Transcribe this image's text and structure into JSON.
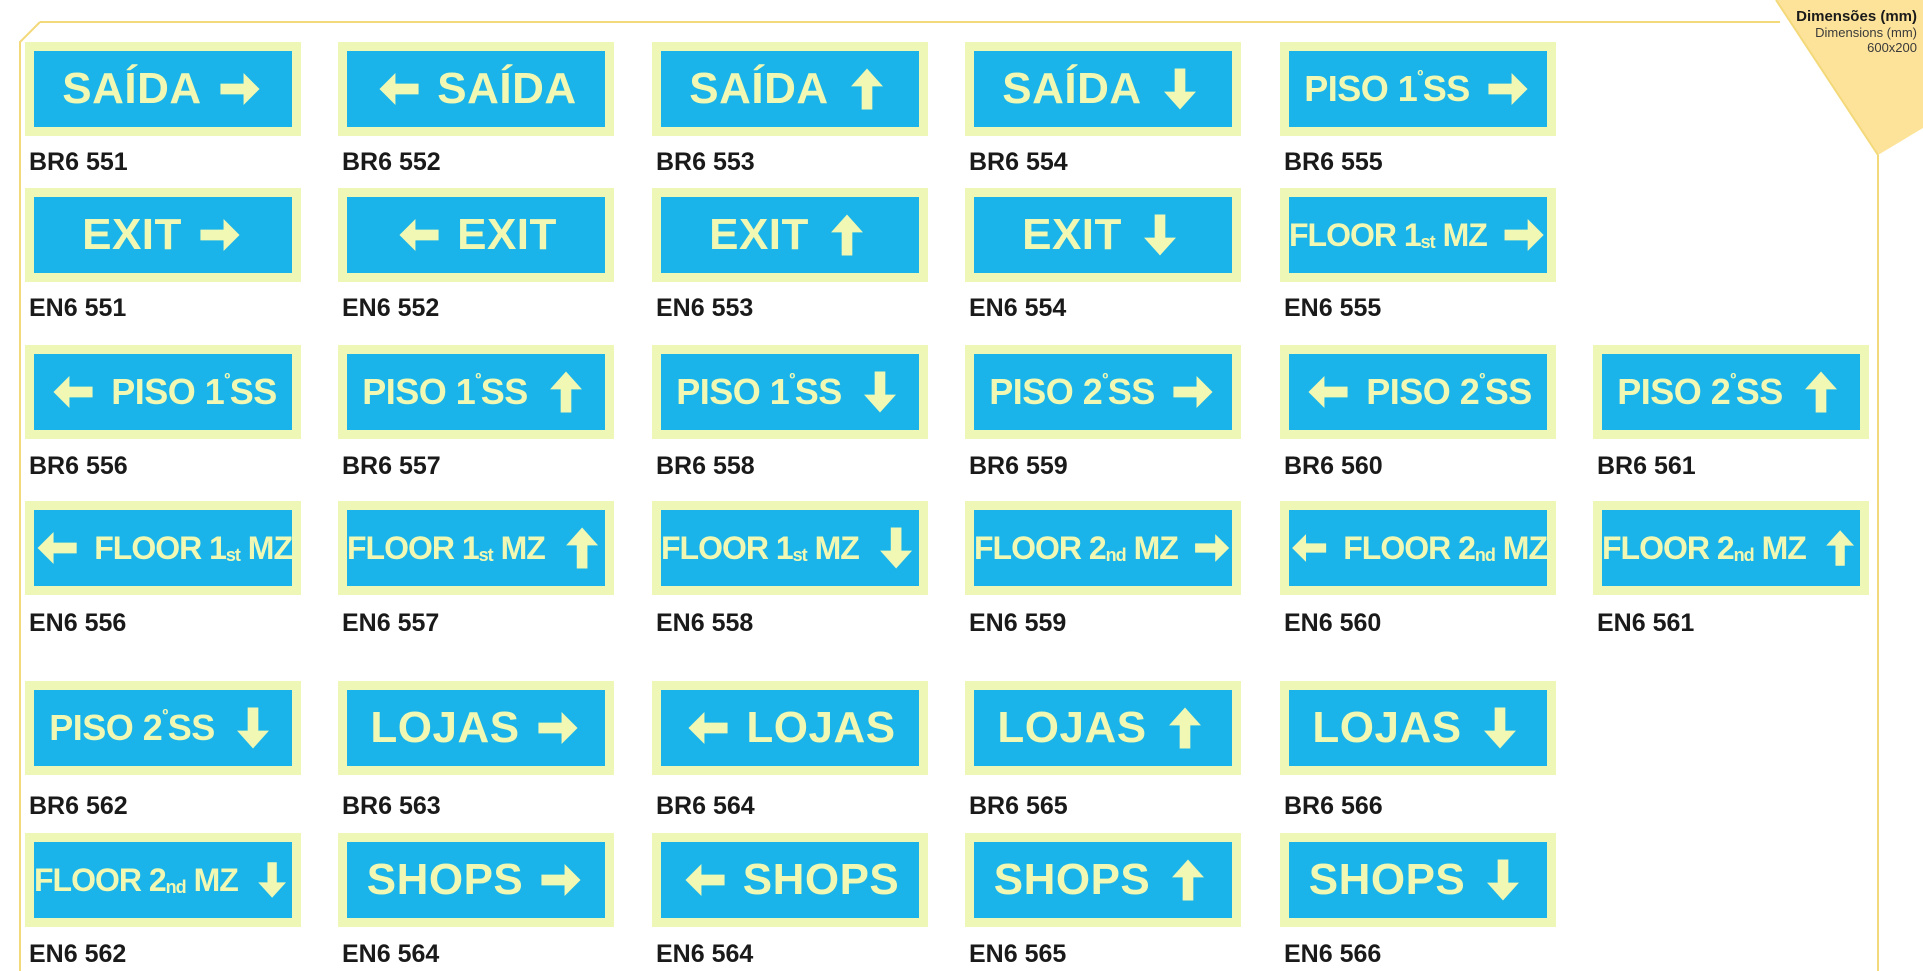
{
  "corner": {
    "title": "Dimensões (mm)",
    "subtitle": "Dimensions (mm)",
    "size": "600x200"
  },
  "colors": {
    "sign_bg": "#1ab4ea",
    "sign_border": "#eef7b6",
    "sign_text": "#f1f8b3",
    "frame_line": "#f3d97a",
    "corner_fill": "#fde39a"
  },
  "signs": [
    {
      "text": "SAÍDA",
      "arrow": "arrow-right",
      "code": "BR6 551"
    },
    {
      "text": "SAÍDA",
      "arrow": "arrow-left",
      "code": "BR6 552"
    },
    {
      "text": "SAÍDA",
      "arrow": "arrow-up",
      "code": "BR6 553"
    },
    {
      "text": "SAÍDA",
      "arrow": "arrow-down",
      "code": "BR6 554"
    },
    {
      "text": "PISO 1",
      "sup": "º",
      "rest": "SS",
      "arrow": "arrow-right",
      "code": "BR6 555"
    },
    {
      "text": "EXIT",
      "arrow": "arrow-right",
      "code": "EN6 551"
    },
    {
      "text": "EXIT",
      "arrow": "arrow-left",
      "code": "EN6 552"
    },
    {
      "text": "EXIT",
      "arrow": "arrow-up",
      "code": "EN6 553"
    },
    {
      "text": "EXIT",
      "arrow": "arrow-down",
      "code": "EN6 554"
    },
    {
      "text": "FLOOR 1",
      "sub": "st",
      "rest": " MZ",
      "arrow": "arrow-right",
      "code": "EN6 555"
    },
    {
      "text": "PISO 1",
      "sup": "º",
      "rest": "SS",
      "arrow": "arrow-left",
      "code": "BR6 556"
    },
    {
      "text": "PISO 1",
      "sup": "º",
      "rest": "SS",
      "arrow": "arrow-up",
      "code": "BR6 557"
    },
    {
      "text": "PISO 1",
      "sup": "º",
      "rest": "SS",
      "arrow": "arrow-down",
      "code": "BR6 558"
    },
    {
      "text": "PISO 2",
      "sup": "º",
      "rest": "SS",
      "arrow": "arrow-right",
      "code": "BR6 559"
    },
    {
      "text": "PISO 2",
      "sup": "º",
      "rest": "SS",
      "arrow": "arrow-left",
      "code": "BR6 560"
    },
    {
      "text": "PISO 2",
      "sup": "º",
      "rest": "SS",
      "arrow": "arrow-up",
      "code": "BR6 561"
    },
    {
      "text": "FLOOR 1",
      "sub": "st",
      "rest": " MZ",
      "arrow": "arrow-left",
      "code": "EN6 556"
    },
    {
      "text": "FLOOR 1",
      "sub": "st",
      "rest": " MZ",
      "arrow": "arrow-up",
      "code": "EN6 557"
    },
    {
      "text": "FLOOR 1",
      "sub": "st",
      "rest": " MZ",
      "arrow": "arrow-down",
      "code": "EN6 558"
    },
    {
      "text": "FLOOR 2",
      "sub": "nd",
      "rest": " MZ",
      "arrow": "arrow-right",
      "code": "EN6 559"
    },
    {
      "text": "FLOOR 2",
      "sub": "nd",
      "rest": " MZ",
      "arrow": "arrow-left",
      "code": "EN6 560"
    },
    {
      "text": "FLOOR 2",
      "sub": "nd",
      "rest": " MZ",
      "arrow": "arrow-up",
      "code": "EN6 561"
    },
    {
      "text": "PISO 2",
      "sup": "º",
      "rest": "SS",
      "arrow": "arrow-down",
      "code": "BR6 562"
    },
    {
      "text": "LOJAS",
      "arrow": "arrow-right",
      "code": "BR6 563"
    },
    {
      "text": "LOJAS",
      "arrow": "arrow-left",
      "code": "BR6 564"
    },
    {
      "text": "LOJAS",
      "arrow": "arrow-up",
      "code": "BR6 565"
    },
    {
      "text": "LOJAS",
      "arrow": "arrow-down",
      "code": "BR6 566"
    },
    {
      "text": "FLOOR 2",
      "sub": "nd",
      "rest": " MZ",
      "arrow": "arrow-down",
      "code": "EN6 562"
    },
    {
      "text": "SHOPS",
      "arrow": "arrow-right",
      "code": "EN6 564"
    },
    {
      "text": "SHOPS",
      "arrow": "arrow-left",
      "code": "EN6 564"
    },
    {
      "text": "SHOPS",
      "arrow": "arrow-up",
      "code": "EN6 565"
    },
    {
      "text": "SHOPS",
      "arrow": "arrow-down",
      "code": "EN6 566"
    }
  ]
}
